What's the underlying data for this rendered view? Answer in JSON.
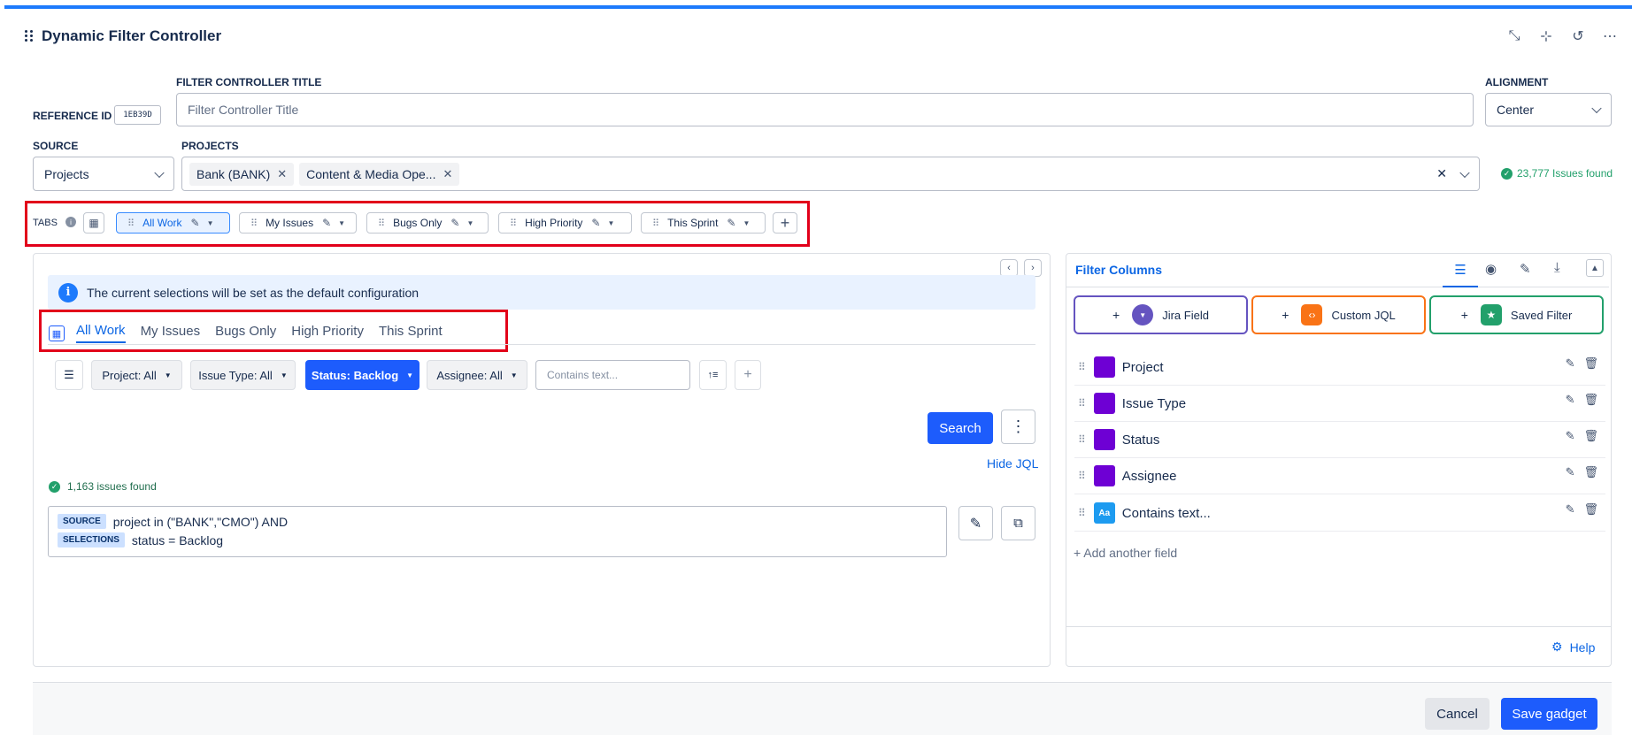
{
  "header": {
    "title": "Dynamic Filter Controller",
    "icons": [
      "collapse-icon",
      "shrink-icon",
      "refresh-icon",
      "more-icon"
    ]
  },
  "form": {
    "reference_label": "REFERENCE ID",
    "reference_id": "1EB39D",
    "title_label": "FILTER CONTROLLER TITLE",
    "title_placeholder": "Filter Controller Title",
    "alignment_label": "ALIGNMENT",
    "alignment_value": "Center",
    "source_label": "SOURCE",
    "source_value": "Projects",
    "projects_label": "PROJECTS",
    "projects": [
      "Bank (BANK)",
      "Content & Media Ope..."
    ],
    "issues_found": "23,777 Issues found"
  },
  "tabs": {
    "label": "TABS",
    "items": [
      {
        "label": "All Work",
        "active": true
      },
      {
        "label": "My Issues",
        "active": false
      },
      {
        "label": "Bugs Only",
        "active": false
      },
      {
        "label": "High Priority",
        "active": false
      },
      {
        "label": "This Sprint",
        "active": false
      }
    ]
  },
  "preview": {
    "info_text": "The current selections will be set as the default configuration",
    "inner_tabs": [
      "All Work",
      "My Issues",
      "Bugs Only",
      "High Priority",
      "This Sprint"
    ],
    "filters": [
      {
        "label": "Project: All",
        "active": false
      },
      {
        "label": "Issue Type: All",
        "active": false
      },
      {
        "label": "Status: Backlog",
        "active": true
      },
      {
        "label": "Assignee: All",
        "active": false
      }
    ],
    "contains_placeholder": "Contains text...",
    "search_label": "Search",
    "hide_jql_label": "Hide JQL",
    "issues_found": "1,163 issues found",
    "jql_source_tag": "SOURCE",
    "jql_source_text": "project in (\"BANK\",\"CMO\") AND",
    "jql_selections_tag": "SELECTIONS",
    "jql_selections_text": "status = Backlog"
  },
  "filter_columns": {
    "title": "Filter Columns",
    "add_buttons": [
      {
        "label": "Jira Field",
        "color": "#6554c0"
      },
      {
        "label": "Custom JQL",
        "color": "#f97316"
      },
      {
        "label": "Saved Filter",
        "color": "#22a06b"
      }
    ],
    "fields": [
      {
        "name": "Project",
        "icon": "purple-square"
      },
      {
        "name": "Issue Type",
        "icon": "purple-square"
      },
      {
        "name": "Status",
        "icon": "purple-square"
      },
      {
        "name": "Assignee",
        "icon": "purple-square"
      },
      {
        "name": "Contains text...",
        "icon": "Aa"
      }
    ],
    "add_another": "+ Add another field",
    "help_label": "Help"
  },
  "footer": {
    "cancel_label": "Cancel",
    "save_label": "Save gadget"
  },
  "colors": {
    "primary": "#1d5cfc",
    "highlight_box": "#e2001a",
    "success": "#22a06b"
  }
}
